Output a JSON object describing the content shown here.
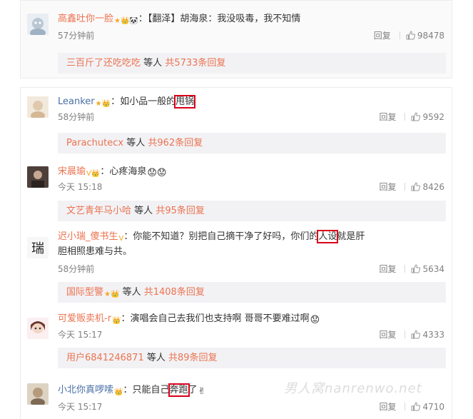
{
  "comments": [
    {
      "user": "高鑫吐你一脸",
      "badges": "★ 👑 🐼",
      "text_pre": "【翻泽】胡海泉：我没吸毒，我不知情",
      "time": "57分钟前",
      "reply": "回复",
      "likes": "98478",
      "sub_user": "三百斤了还吃吃吃",
      "sub_mid": "等人",
      "sub_count": "共5733条回复"
    },
    {
      "user": "Leanker",
      "badges": "★ 👑",
      "text_pre": "如小品一般的",
      "text_hl": "甩锅",
      "time": "58分钟前",
      "reply": "回复",
      "likes": "9592",
      "sub_user": "Parachutecx",
      "sub_mid": "等人",
      "sub_count": "共962条回复"
    },
    {
      "user": "宋晨瑜",
      "badges": "V 👑",
      "text_pre": "心疼海泉",
      "time": "今天 15:18",
      "reply": "回复",
      "likes": "8426",
      "sub_user": "文艺青年马小哈",
      "sub_mid": "等人",
      "sub_count": "共95条回复"
    },
    {
      "user": "迟小瑞_傻书生",
      "badges": "V",
      "text_pre": "你能不知道？别把自己摘干净了好吗，你们的",
      "text_hl": "人设",
      "text_post": "就是肝",
      "text_line2": "胆相照患难与共。",
      "time": "58分钟前",
      "reply": "回复",
      "likes": "5634",
      "sub_user": "国际型警",
      "sub_mid": "等人",
      "sub_count": "共1408条回复"
    },
    {
      "user": "可爱贩卖机-r",
      "badges": "👑",
      "text_pre": "演唱会自己去我们也支持啊 哥哥不要难过啊",
      "time": "今天 15:17",
      "reply": "回复",
      "likes": "4333",
      "sub_user": "用户6841246871",
      "sub_mid": "等人",
      "sub_count": "共89条回复"
    },
    {
      "user": "小北你真啰嗦",
      "badges": "👑",
      "text_pre": "只能自己",
      "text_hl": "奔跑",
      "text_post": "了",
      "time": "今天 15:17",
      "reply": "回复",
      "likes": "4710"
    }
  ],
  "watermark": "男人窝nanrenwo.net",
  "colors": {
    "username": "#eb7350",
    "link": "#eb7350",
    "highlight_box": "#d8001a",
    "meta": "#808080"
  }
}
